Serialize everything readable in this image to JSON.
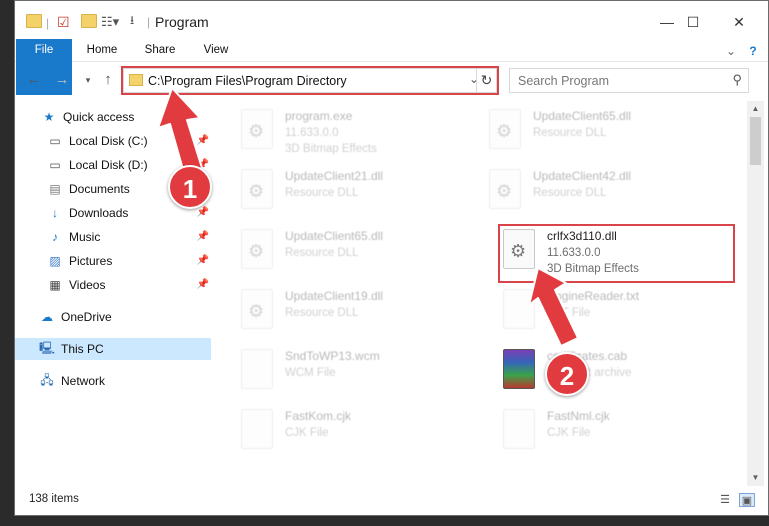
{
  "window": {
    "title": "Program",
    "ribbon_tabs": [
      "File",
      "Home",
      "Share",
      "View"
    ]
  },
  "address": {
    "path": "C:\\Program Files\\Program Directory",
    "search_placeholder": "Search Program"
  },
  "nav": {
    "quick_access": "Quick access",
    "items": [
      {
        "label": "Local Disk (C:)",
        "icon": "drive-icon",
        "pinned": true
      },
      {
        "label": "Local Disk (D:)",
        "icon": "drive-icon",
        "pinned": true
      },
      {
        "label": "Documents",
        "icon": "documents-icon",
        "pinned": true
      },
      {
        "label": "Downloads",
        "icon": "downloads-icon",
        "pinned": true
      },
      {
        "label": "Music",
        "icon": "music-icon",
        "pinned": true
      },
      {
        "label": "Pictures",
        "icon": "pictures-icon",
        "pinned": true
      },
      {
        "label": "Videos",
        "icon": "videos-icon",
        "pinned": true
      }
    ],
    "onedrive": "OneDrive",
    "this_pc": "This PC",
    "network": "Network"
  },
  "files": [
    {
      "name": "program.exe",
      "line2": "11.633.0.0",
      "line3": "3D Bitmap Effects"
    },
    {
      "name": "UpdateClient65.dll",
      "line2": "Resource DLL",
      "line3": ""
    },
    {
      "name": "UpdateClient21.dll",
      "line2": "Resource DLL",
      "line3": ""
    },
    {
      "name": "UpdateClient42.dll",
      "line2": "Resource DLL",
      "line3": ""
    },
    {
      "name": "UpdateClient65.dll",
      "line2": "Resource DLL",
      "line3": ""
    },
    {
      "name": "crlfx3d110.dll",
      "line2": "11.633.0.0",
      "line3": "3D Bitmap Effects"
    },
    {
      "name": "UpdateClient19.dll",
      "line2": "Resource DLL",
      "line3": ""
    },
    {
      "name": "EngineReader.txt",
      "line2": "TXT File",
      "line3": ""
    },
    {
      "name": "SndToWP13.wcm",
      "line2": "WCM File",
      "line3": ""
    },
    {
      "name": "certificates.cab",
      "line2": "WinRAR archive",
      "line3": ""
    },
    {
      "name": "FastKom.cjk",
      "line2": "CJK File",
      "line3": ""
    },
    {
      "name": "FastNml.cjk",
      "line2": "CJK File",
      "line3": ""
    }
  ],
  "status": {
    "item_count": "138 items"
  },
  "annotations": {
    "step1": "1",
    "step2": "2"
  },
  "colors": {
    "accent": "#1979ca",
    "highlight": "#d9434a",
    "badge": "#e23b3f"
  }
}
